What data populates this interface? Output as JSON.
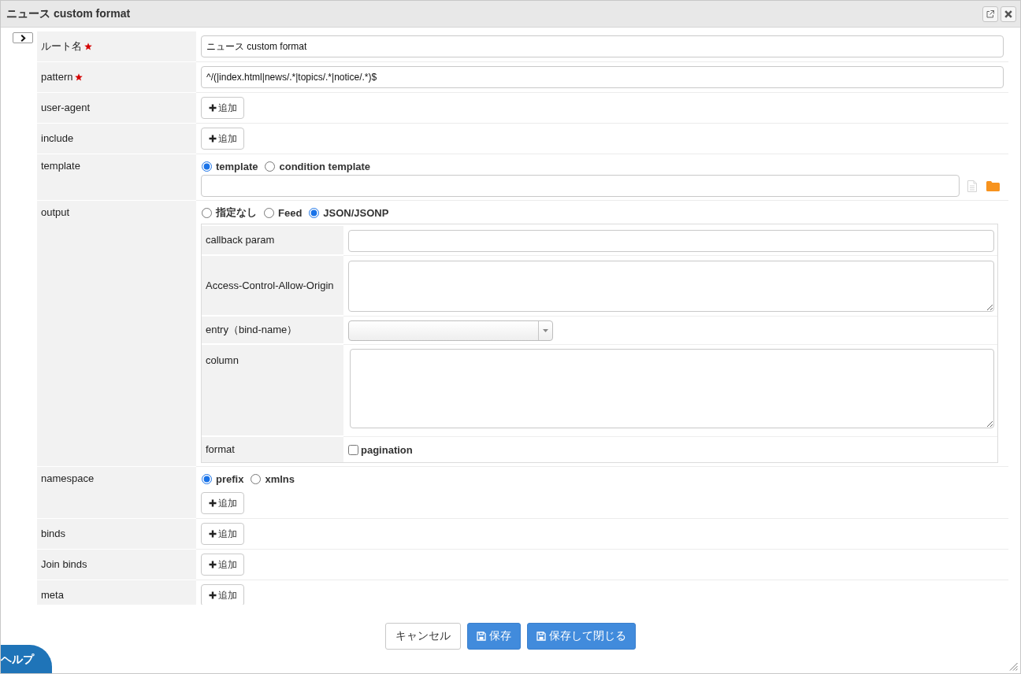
{
  "dialog": {
    "title": "ニュース custom format"
  },
  "fields": [
    {
      "kind": "text",
      "label": "ルート名",
      "required": true,
      "value": "ニュース custom format"
    },
    {
      "kind": "text",
      "label": "pattern",
      "required": true,
      "value": "^/(|index.html|news/.*|topics/.*|notice/.*)$"
    },
    {
      "kind": "add",
      "label": "user-agent",
      "required": false,
      "button": "追加"
    },
    {
      "kind": "add",
      "label": "include",
      "required": false,
      "button": "追加"
    },
    {
      "kind": "file",
      "label": "template",
      "required": false,
      "options": [
        {
          "label": "template",
          "selected": true
        },
        {
          "label": "condition template",
          "selected": false
        }
      ]
    },
    {
      "kind": "table",
      "label": "output",
      "required": false,
      "options": [
        {
          "label": "指定なし",
          "selected": false
        },
        {
          "label": "Feed",
          "selected": false
        },
        {
          "label": "JSON/JSONP",
          "selected": true
        }
      ],
      "sub_fields": [
        {
          "kind": "input",
          "label": "callback param"
        },
        {
          "kind": "textarea",
          "label": "Access-Control-Allow-Origin"
        },
        {
          "kind": "select",
          "label": "entry（bind-name）"
        },
        {
          "kind": "textarea-tall",
          "label": "column"
        },
        {
          "kind": "checkbox",
          "label": "format",
          "option": "pagination",
          "checked": false
        }
      ]
    },
    {
      "kind": "add",
      "label": "namespace",
      "required": false,
      "options": [
        {
          "label": "prefix",
          "selected": true
        },
        {
          "label": "xmlns",
          "selected": false
        }
      ],
      "button": "追加"
    },
    {
      "kind": "add",
      "label": "binds",
      "required": false,
      "button": "追加"
    },
    {
      "kind": "add",
      "label": "Join binds",
      "required": false,
      "button": "追加"
    },
    {
      "kind": "add",
      "label": "meta",
      "required": false,
      "button": "追加"
    }
  ],
  "footer_buttons": [
    {
      "kind": "plain",
      "label": "キャンセル"
    },
    {
      "kind": "primary",
      "label": "保存"
    },
    {
      "kind": "primary",
      "label": "保存して閉じる"
    }
  ],
  "help_tab": {
    "label": "ヘルプ"
  }
}
